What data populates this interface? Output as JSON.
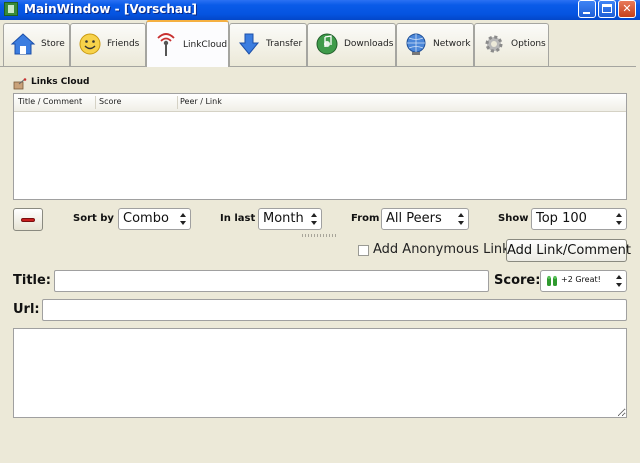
{
  "window": {
    "title": "MainWindow - [Vorschau]"
  },
  "tabs": [
    {
      "label": "Store",
      "icon": "home-icon"
    },
    {
      "label": "Friends",
      "icon": "smiley-icon"
    },
    {
      "label": "LinkCloud",
      "icon": "antenna-icon",
      "active": true
    },
    {
      "label": "Transfer",
      "icon": "download-arrow-icon"
    },
    {
      "label": "Downloads",
      "icon": "music-cd-icon"
    },
    {
      "label": "Network",
      "icon": "globe-network-icon"
    },
    {
      "label": "Options",
      "icon": "gear-icon"
    }
  ],
  "links_cloud": {
    "title": "Links Cloud",
    "columns": [
      "Title / Comment",
      "Score",
      "Peer / Link"
    ]
  },
  "filters": {
    "sort_by_label": "Sort by",
    "sort_by_value": "Combo",
    "in_last_label": "In last",
    "in_last_value": "Month",
    "from_label": "From",
    "from_value": "All Peers",
    "show_label": "Show",
    "show_value": "Top 100"
  },
  "add_form": {
    "anonymous_label": "Add Anonymous Link",
    "anonymous_checked": false,
    "add_button": "Add Link/Comment",
    "title_label": "Title:",
    "title_value": "",
    "score_label": "Score:",
    "score_value": "+2 Great!",
    "url_label": "Url:",
    "url_value": "",
    "comment_value": ""
  },
  "colors": {
    "titlebar": "#0A5BE8",
    "panel": "#ECE9D8",
    "active_tab_accent": "#F5B042",
    "remove_red": "#C81E1E"
  }
}
